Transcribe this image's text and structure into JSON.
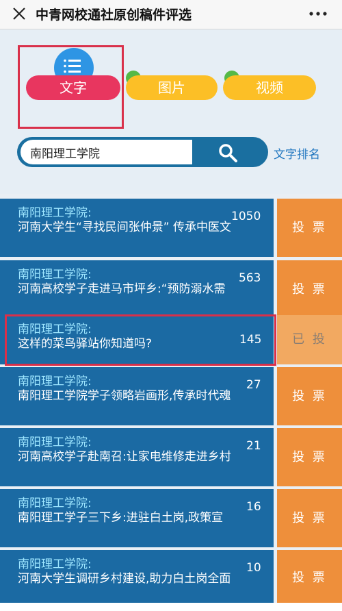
{
  "window": {
    "title": "中青网校通社原创稿件评选"
  },
  "tabs": [
    {
      "label": "文字"
    },
    {
      "label": "图片"
    },
    {
      "label": "视频"
    }
  ],
  "search": {
    "value": "南阳理工学院",
    "rank_link": "文字排名"
  },
  "colors": {
    "tab_active": "#e8365f",
    "tab_inactive": "#fcbf26",
    "card": "#1b6aa3",
    "vote": "#ee8f3b",
    "highlight": "#d9304a"
  },
  "articles": [
    {
      "source": "南阳理工学院:",
      "headline": "河南大学生“寻找民间张仲景” 传承中医文",
      "votes": "1050",
      "vote_label": "投 票"
    },
    {
      "source": "南阳理工学院:",
      "headline": "河南高校学子走进马市坪乡:“预防溺水需",
      "votes": "563",
      "vote_label": "投 票"
    },
    {
      "source": "南阳理工学院:",
      "headline": "这样的菜鸟驿站你知道吗?",
      "votes": "145",
      "vote_label": "已 投"
    },
    {
      "source": "南阳理工学院:",
      "headline": "南阳理工学院学子领略岩画形,传承时代魂",
      "votes": "27",
      "vote_label": "投 票"
    },
    {
      "source": "南阳理工学院:",
      "headline": "河南高校学子赴南召:让家电维修走进乡村",
      "votes": "21",
      "vote_label": "投 票"
    },
    {
      "source": "南阳理工学院:",
      "headline": "南阳理工学子三下乡:进驻白土岗,政策宣",
      "votes": "16",
      "vote_label": "投 票"
    },
    {
      "source": "南阳理工学院:",
      "headline": "河南大学生调研乡村建设,助力白土岗全面",
      "votes": "10",
      "vote_label": "投 票"
    }
  ]
}
